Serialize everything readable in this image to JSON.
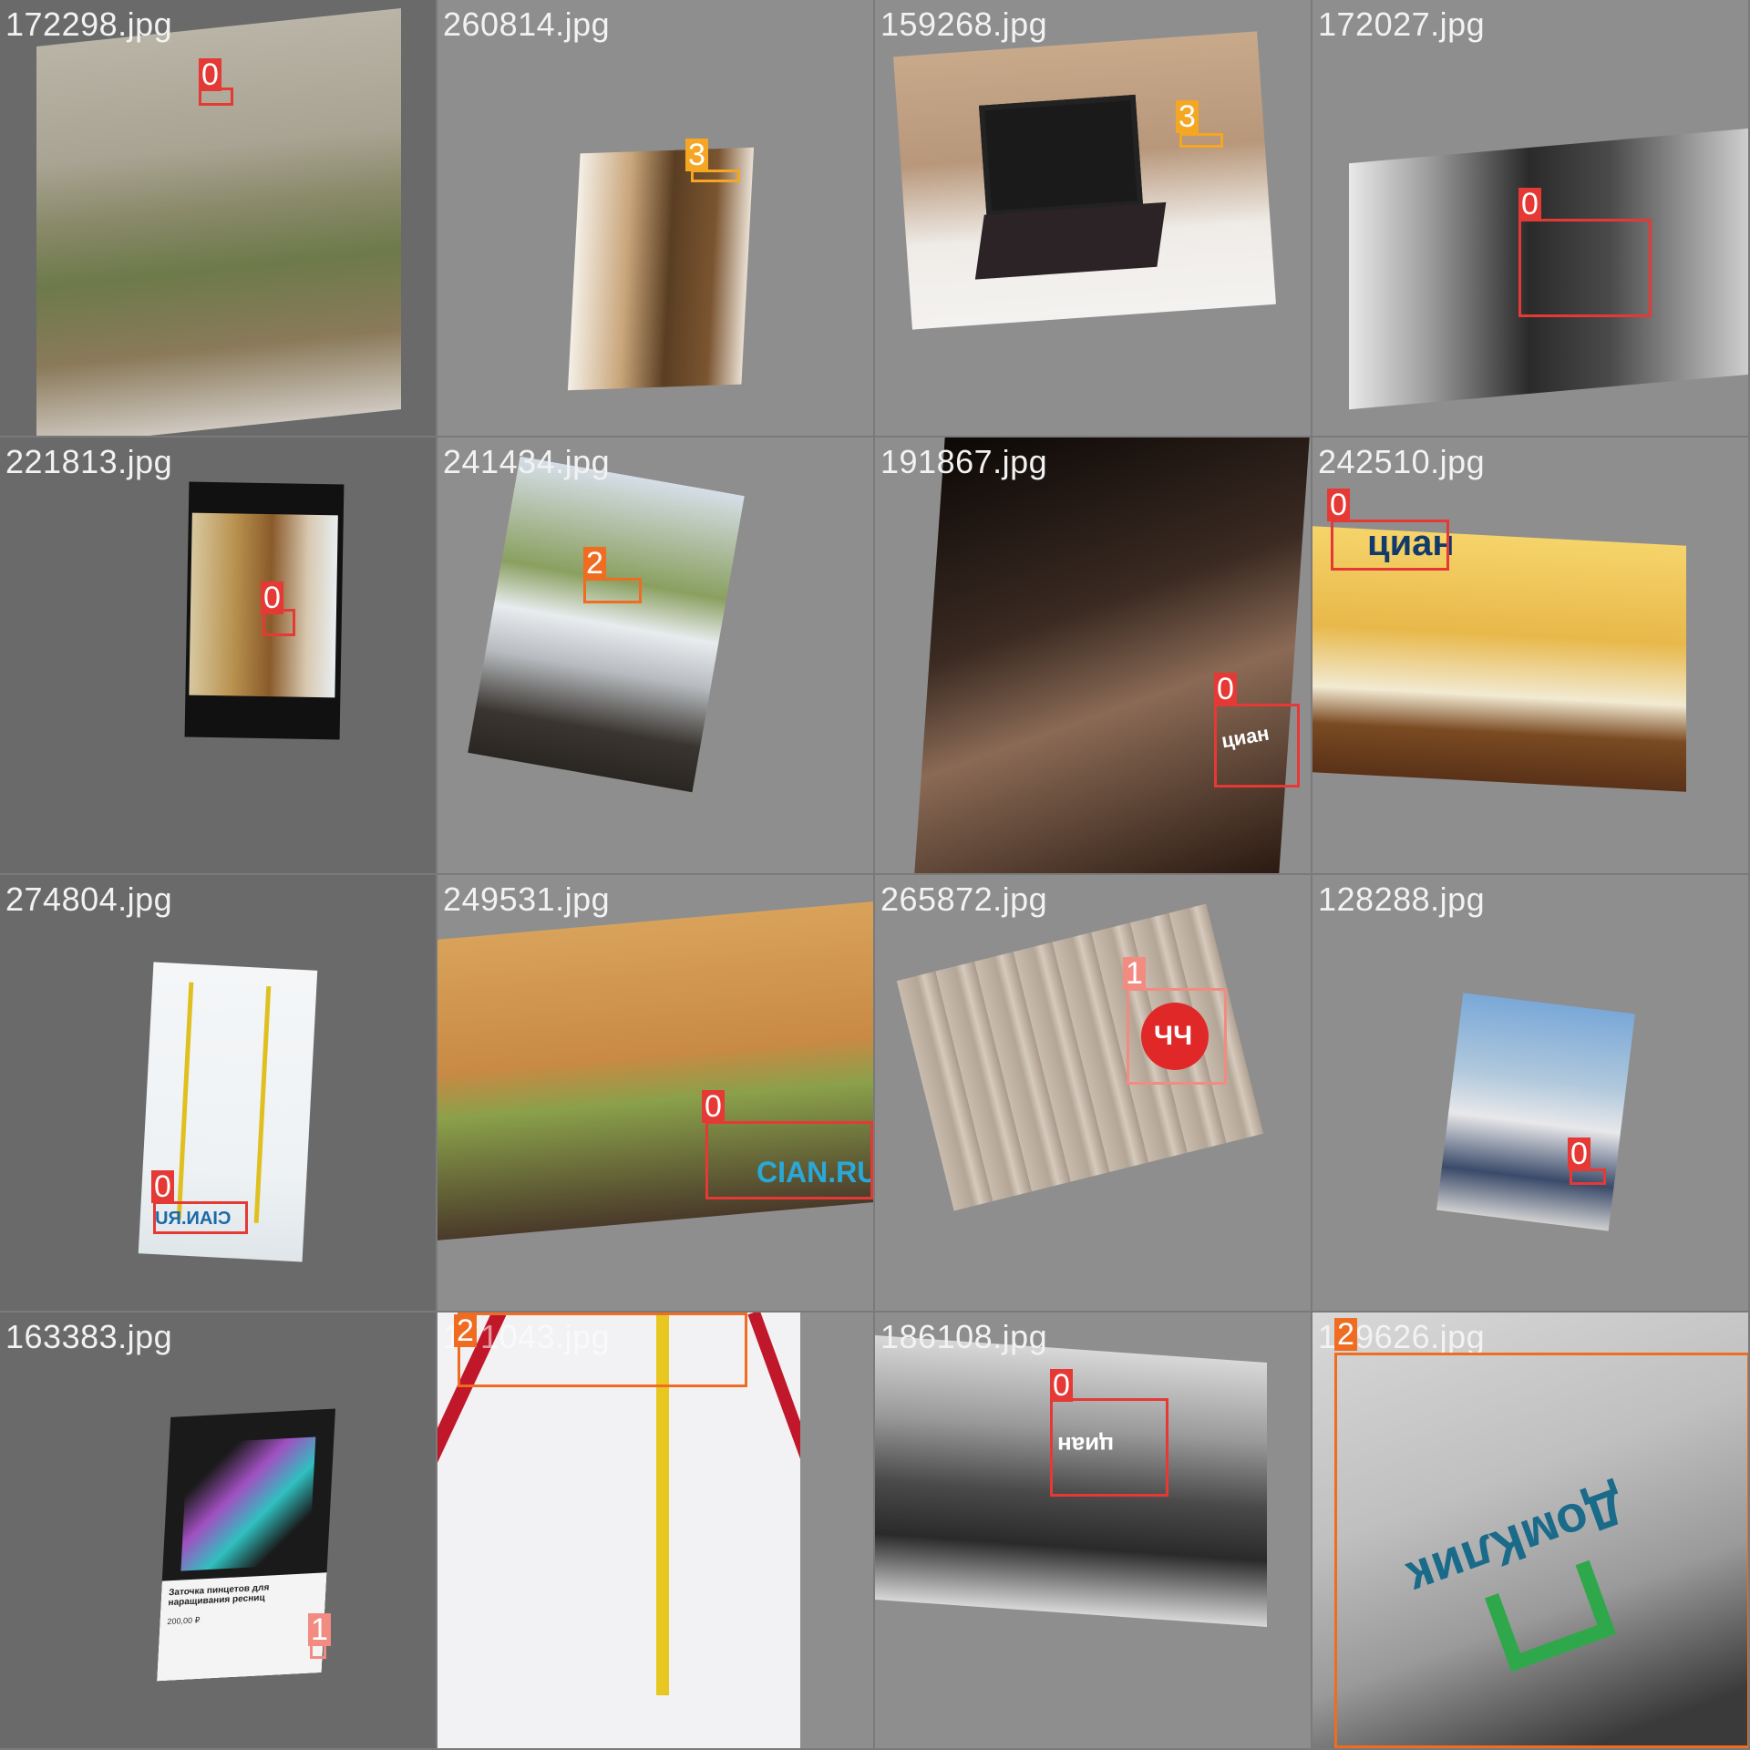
{
  "colors": {
    "class_0": "#e53935",
    "class_1": "#f28b82",
    "class_2": "#ef6c21",
    "class_3": "#f5a623"
  },
  "tiles": [
    {
      "filename": "172298.jpg",
      "boxes": [
        {
          "label": "0"
        }
      ]
    },
    {
      "filename": "260814.jpg",
      "boxes": [
        {
          "label": "3"
        }
      ]
    },
    {
      "filename": "159268.jpg",
      "boxes": [
        {
          "label": "3"
        }
      ]
    },
    {
      "filename": "172027.jpg",
      "boxes": [
        {
          "label": "0"
        }
      ]
    },
    {
      "filename": "221813.jpg",
      "boxes": [
        {
          "label": "0"
        }
      ]
    },
    {
      "filename": "241434.jpg",
      "boxes": [
        {
          "label": "2"
        }
      ]
    },
    {
      "filename": "191867.jpg",
      "boxes": [
        {
          "label": "0"
        }
      ],
      "watermark": "циан"
    },
    {
      "filename": "242510.jpg",
      "boxes": [
        {
          "label": "0"
        }
      ],
      "watermark": "циан"
    },
    {
      "filename": "274804.jpg",
      "boxes": [
        {
          "label": "0"
        }
      ],
      "watermark": "CIAN.RU"
    },
    {
      "filename": "249531.jpg",
      "boxes": [
        {
          "label": "0"
        }
      ],
      "watermark": "CIAN.RU"
    },
    {
      "filename": "265872.jpg",
      "boxes": [
        {
          "label": "1"
        }
      ],
      "watermark": "ЧЧ"
    },
    {
      "filename": "128288.jpg",
      "boxes": [
        {
          "label": "0"
        }
      ]
    },
    {
      "filename": "163383.jpg",
      "boxes": [
        {
          "label": "1"
        }
      ],
      "caption": "Заточка пинцетов для наращивания ресниц",
      "price": "200,00 ₽"
    },
    {
      "filename": "171043.jpg",
      "boxes": [
        {
          "label": "2"
        }
      ]
    },
    {
      "filename": "186108.jpg",
      "boxes": [
        {
          "label": "0"
        }
      ],
      "watermark": "циан"
    },
    {
      "filename": "129626.jpg",
      "boxes": [
        {
          "label": "2"
        }
      ],
      "watermark": "ДомКлик"
    }
  ]
}
